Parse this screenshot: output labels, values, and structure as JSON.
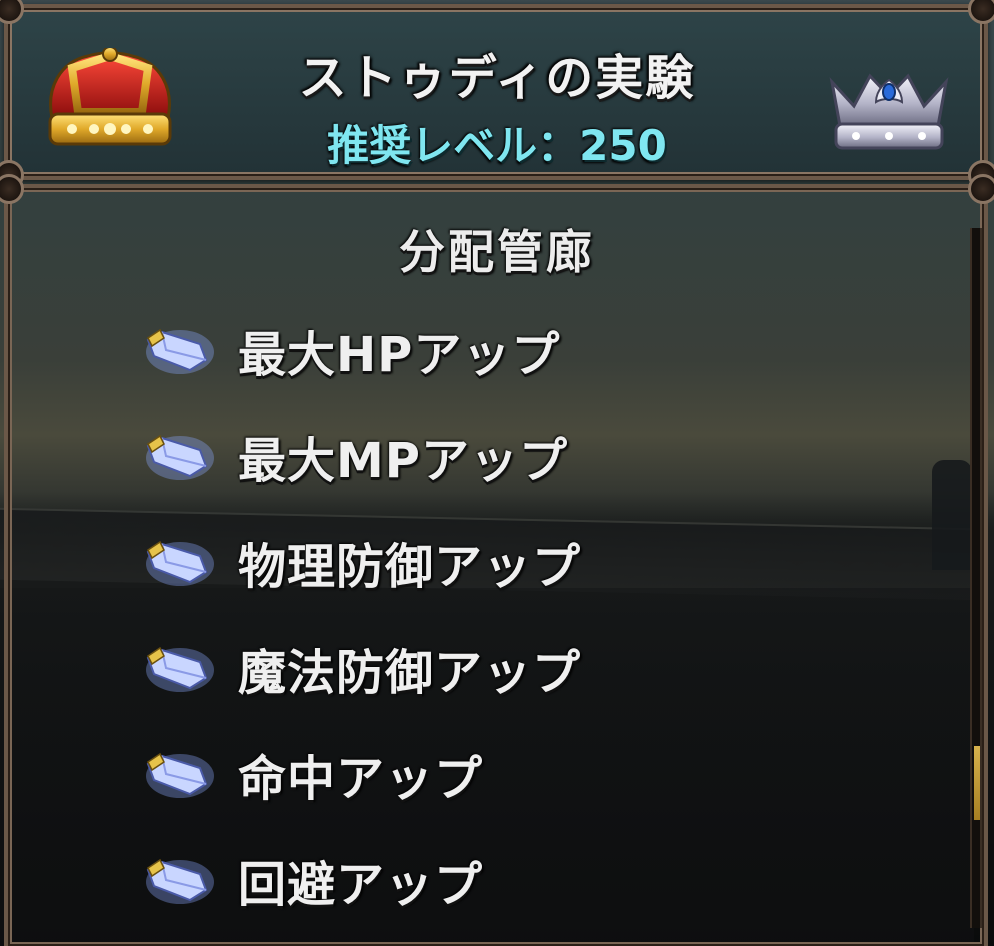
{
  "header": {
    "title": "ストゥディの実験",
    "recommended_level": "推奨レベル：250"
  },
  "panel": {
    "section_title": "分配管廊",
    "items": [
      {
        "label": "最大HPアップ"
      },
      {
        "label": "最大MPアップ"
      },
      {
        "label": "物理防御アップ"
      },
      {
        "label": "魔法防御アップ"
      },
      {
        "label": "命中アップ"
      },
      {
        "label": "回避アップ"
      }
    ]
  },
  "icons": {
    "left_crown": "gold-crown-icon",
    "right_crown": "silver-crown-icon",
    "item_icon": "crystal-gem-icon"
  },
  "colors": {
    "level_text": "#7fe6f0",
    "frame": "#6b5848",
    "scroll_thumb": "#d8b24c"
  },
  "scroll": {
    "position_fraction": 0.74
  }
}
